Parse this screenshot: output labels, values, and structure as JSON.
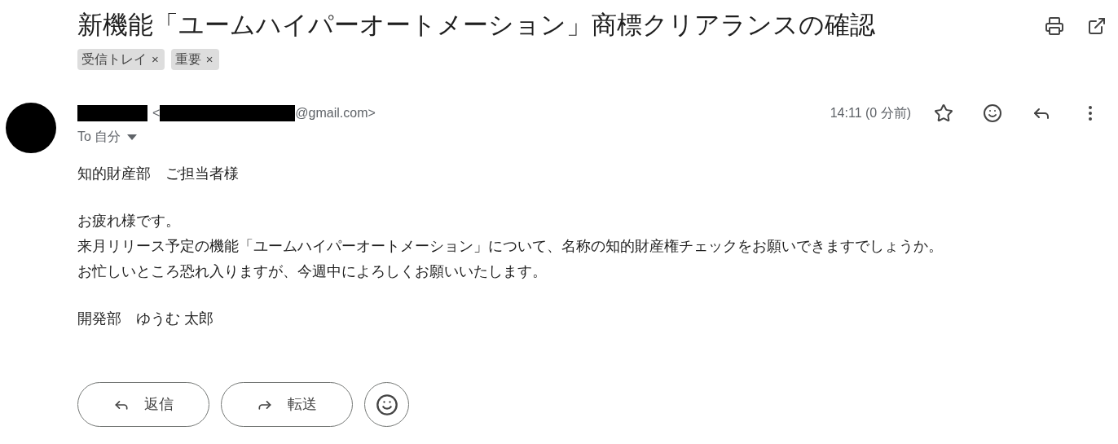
{
  "subject": "新機能「ユームハイパーオートメーション」商標クリアランスの確認",
  "labels": [
    {
      "text": "受信トレイ",
      "remove": "×"
    },
    {
      "text": "重要",
      "remove": "×"
    }
  ],
  "sender": {
    "open_bracket": "<",
    "email_domain": "@gmail.com>",
    "recipient": "To 自分"
  },
  "time": "14:11 (0 分前)",
  "starred": false,
  "body": [
    [
      "知的財産部　ご担当者様"
    ],
    [
      "お疲れ様です。",
      "来月リリース予定の機能「ユームハイパーオートメーション」について、名称の知的財産権チェックをお願いできますでしょうか。",
      "お忙しいところ恐れ入りますが、今週中によろしくお願いいたします。"
    ],
    [
      "開発部　ゆうむ 太郎"
    ]
  ],
  "actions": [
    {
      "kind": "reply",
      "label": "返信"
    },
    {
      "kind": "forward",
      "label": "転送"
    },
    {
      "kind": "emoji"
    }
  ]
}
